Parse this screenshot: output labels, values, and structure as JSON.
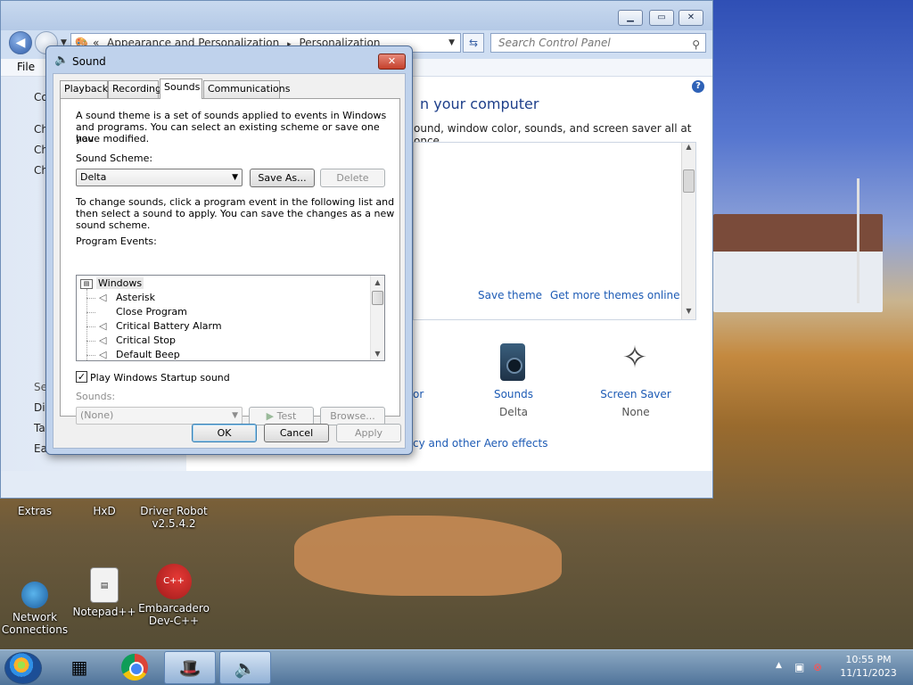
{
  "control_panel": {
    "breadcrumb_prefix": "«",
    "breadcrumb": [
      "Appearance and Personalization",
      "Personalization"
    ],
    "breadcrumb_sep": "▸",
    "search_placeholder": "Search Control Panel",
    "menu_file": "File",
    "heading": "n your computer",
    "subtext": "ound, window color, sounds, and screen saver all at once.",
    "save_theme": "Save theme",
    "get_more_themes": "Get more themes online",
    "sounds_label": "Sounds",
    "sounds_value": "Delta",
    "screen_saver_label": "Screen Saver",
    "screen_saver_value": "None",
    "color_fragment": "or",
    "aero_fragment": "cy and other Aero effects",
    "sidebar_fragments": [
      "Co",
      "Ch",
      "Ch",
      "Ch",
      "Se",
      "Dis",
      "Ta",
      "Ea"
    ]
  },
  "sound_dialog": {
    "title": "Sound",
    "tabs": [
      "Playback",
      "Recording",
      "Sounds",
      "Communications"
    ],
    "intro_lines": [
      "A sound theme is a set of sounds applied to events in Windows",
      "and programs.  You can select an existing scheme or save one you",
      "have modified."
    ],
    "scheme_label": "Sound Scheme:",
    "scheme_value": "Delta",
    "save_as": "Save As...",
    "delete": "Delete",
    "instructions_lines": [
      "To change sounds, click a program event in the following list and",
      "then select a sound to apply.  You can save the changes as a new",
      "sound scheme."
    ],
    "program_events_label": "Program Events:",
    "events_group": "Windows",
    "events": [
      "Asterisk",
      "Close Program",
      "Critical Battery Alarm",
      "Critical Stop",
      "Default Beep"
    ],
    "startup_checkbox": "Play Windows Startup sound",
    "sounds_field_label": "Sounds:",
    "sounds_value": "(None)",
    "test": "Test",
    "browse": "Browse...",
    "ok": "OK",
    "cancel": "Cancel",
    "apply": "Apply"
  },
  "desktop_icons": [
    {
      "label": "Extras"
    },
    {
      "label": "HxD"
    },
    {
      "label_1": "Driver Robot",
      "label_2": "v2.5.4.2"
    },
    {
      "label_1": "Network",
      "label_2": "Connections"
    },
    {
      "label": "Notepad++"
    },
    {
      "label_1": "Embarcadero",
      "label_2": "Dev-C++"
    }
  ],
  "taskbar": {
    "time": "10:55 PM",
    "date": "11/11/2023"
  }
}
